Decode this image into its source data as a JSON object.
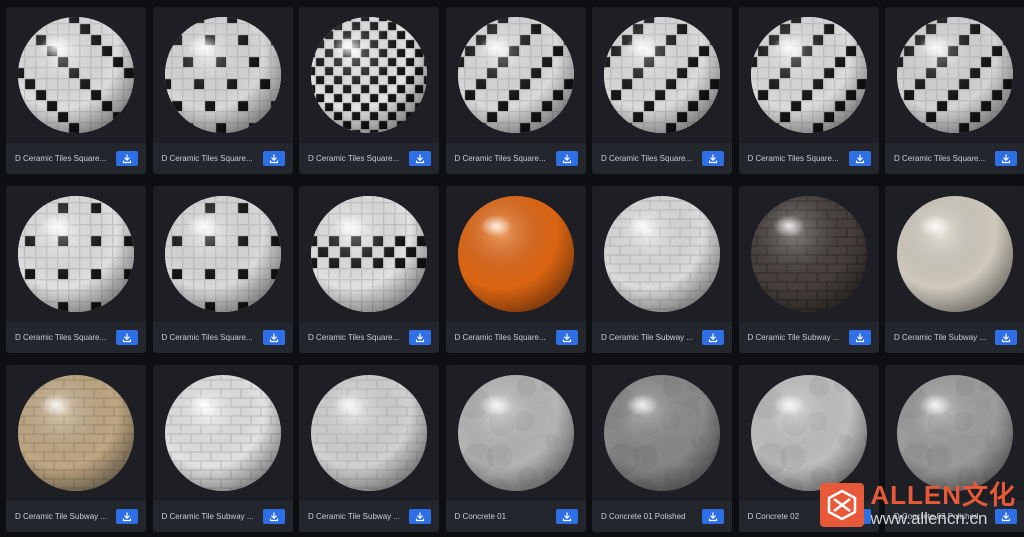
{
  "materials": [
    {
      "name": "D Ceramic Tiles Square...",
      "kind": "checker-sparse",
      "base": "#e9e9e9"
    },
    {
      "name": "D Ceramic Tiles Square...",
      "kind": "checker-sparse2",
      "base": "#e3e3e3"
    },
    {
      "name": "D Ceramic Tiles Square...",
      "kind": "checker-full",
      "base": "#f0f0f0"
    },
    {
      "name": "D Ceramic Tiles Square...",
      "kind": "checker-stair",
      "base": "#e6e6e6"
    },
    {
      "name": "D Ceramic Tiles Square...",
      "kind": "checker-stair",
      "base": "#e8e8e8"
    },
    {
      "name": "D Ceramic Tiles Square...",
      "kind": "checker-stair",
      "base": "#e8e8e8"
    },
    {
      "name": "D Ceramic Tiles Square...",
      "kind": "checker-stair",
      "base": "#e0e0e0"
    },
    {
      "name": "D Ceramic Tiles Square...",
      "kind": "dots",
      "base": "#ececec"
    },
    {
      "name": "D Ceramic Tiles Square...",
      "kind": "dots",
      "base": "#e6e6e6"
    },
    {
      "name": "D Ceramic Tiles Square...",
      "kind": "band",
      "base": "#ededed"
    },
    {
      "name": "D Ceramic Tiles Square...",
      "kind": "glossy",
      "base": "#e86a14"
    },
    {
      "name": "D Ceramic Tile Subway ...",
      "kind": "subway",
      "base": "#e7e7e7"
    },
    {
      "name": "D Ceramic Tile Subway ...",
      "kind": "subway-dark",
      "base": "#4a4340"
    },
    {
      "name": "D Ceramic Tile Subway ...",
      "kind": "plain",
      "base": "#d9d4c6"
    },
    {
      "name": "D Ceramic Tile Subway ...",
      "kind": "subway-warm",
      "base": "#c9b08a"
    },
    {
      "name": "D Ceramic Tile Subway ...",
      "kind": "subway",
      "base": "#eeeeee"
    },
    {
      "name": "D Ceramic Tile Subway ...",
      "kind": "subway",
      "base": "#dcdcdc"
    },
    {
      "name": "D Concrete 01",
      "kind": "concrete",
      "base": "#bdbdbd"
    },
    {
      "name": "D Concrete 01 Polished",
      "kind": "concrete-dark",
      "base": "#8e8e8e"
    },
    {
      "name": "D Concrete 02",
      "kind": "concrete",
      "base": "#c8c8c8"
    },
    {
      "name": "D Concrete 02 Polished",
      "kind": "concrete-dark",
      "base": "#a3a3a3"
    }
  ],
  "icons": {
    "download": "download-icon",
    "logo": "allen-logo-icon"
  },
  "watermark": {
    "brand": "ALLEN文化",
    "url": "www.allencn.cn"
  },
  "colors": {
    "accent": "#2f6fe6",
    "brand": "#e8593a"
  }
}
